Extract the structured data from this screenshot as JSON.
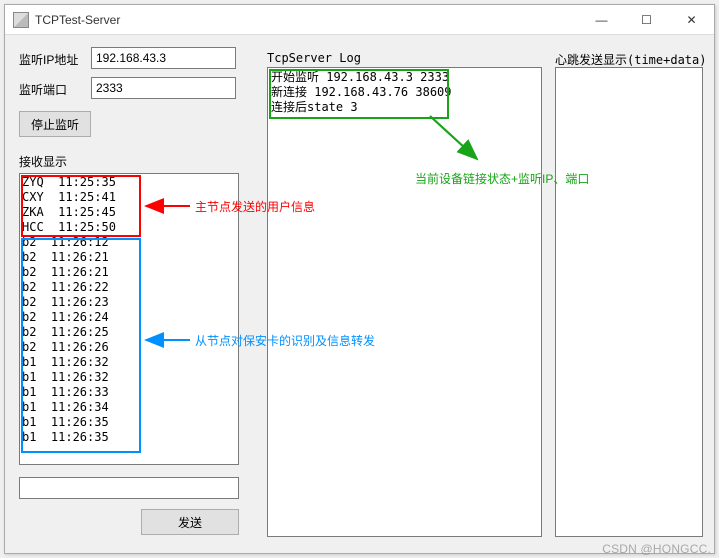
{
  "window": {
    "title": "TCPTest-Server",
    "btn_min": "—",
    "btn_max": "☐",
    "btn_close": "✕"
  },
  "labels": {
    "listen_ip": "监听IP地址",
    "listen_port": "监听端口",
    "stop_listen": "停止监听",
    "recv_display": "接收显示",
    "server_log": "TcpServer Log",
    "heartbeat": "心跳发送显示(time+data)",
    "send": "发送"
  },
  "inputs": {
    "ip_value": "192.168.43.3",
    "port_value": "2333",
    "send_value": ""
  },
  "log_lines": [
    "开始监听 192.168.43.3 2333",
    "新连接 192.168.43.76 38609",
    "连接后state 3"
  ],
  "recv_red": [
    "ZYQ  11:25:35",
    "CXY  11:25:41",
    "ZKA  11:25:45",
    "HCC  11:25:50"
  ],
  "recv_blue": [
    "b2  11:26:12",
    "b2  11:26:21",
    "b2  11:26:21",
    "b2  11:26:22",
    "b2  11:26:23",
    "b2  11:26:24",
    "b2  11:26:25",
    "b2  11:26:26",
    "b1  11:26:32",
    "b1  11:26:32",
    "b1  11:26:33",
    "b1  11:26:34",
    "b1  11:26:35",
    "b1  11:26:35"
  ],
  "annotations": {
    "red": "主节点发送的用户信息",
    "blue": "从节点对保安卡的识别及信息转发",
    "green": "当前设备链接状态+监听IP、端口"
  },
  "watermark": "CSDN @HONGCC."
}
